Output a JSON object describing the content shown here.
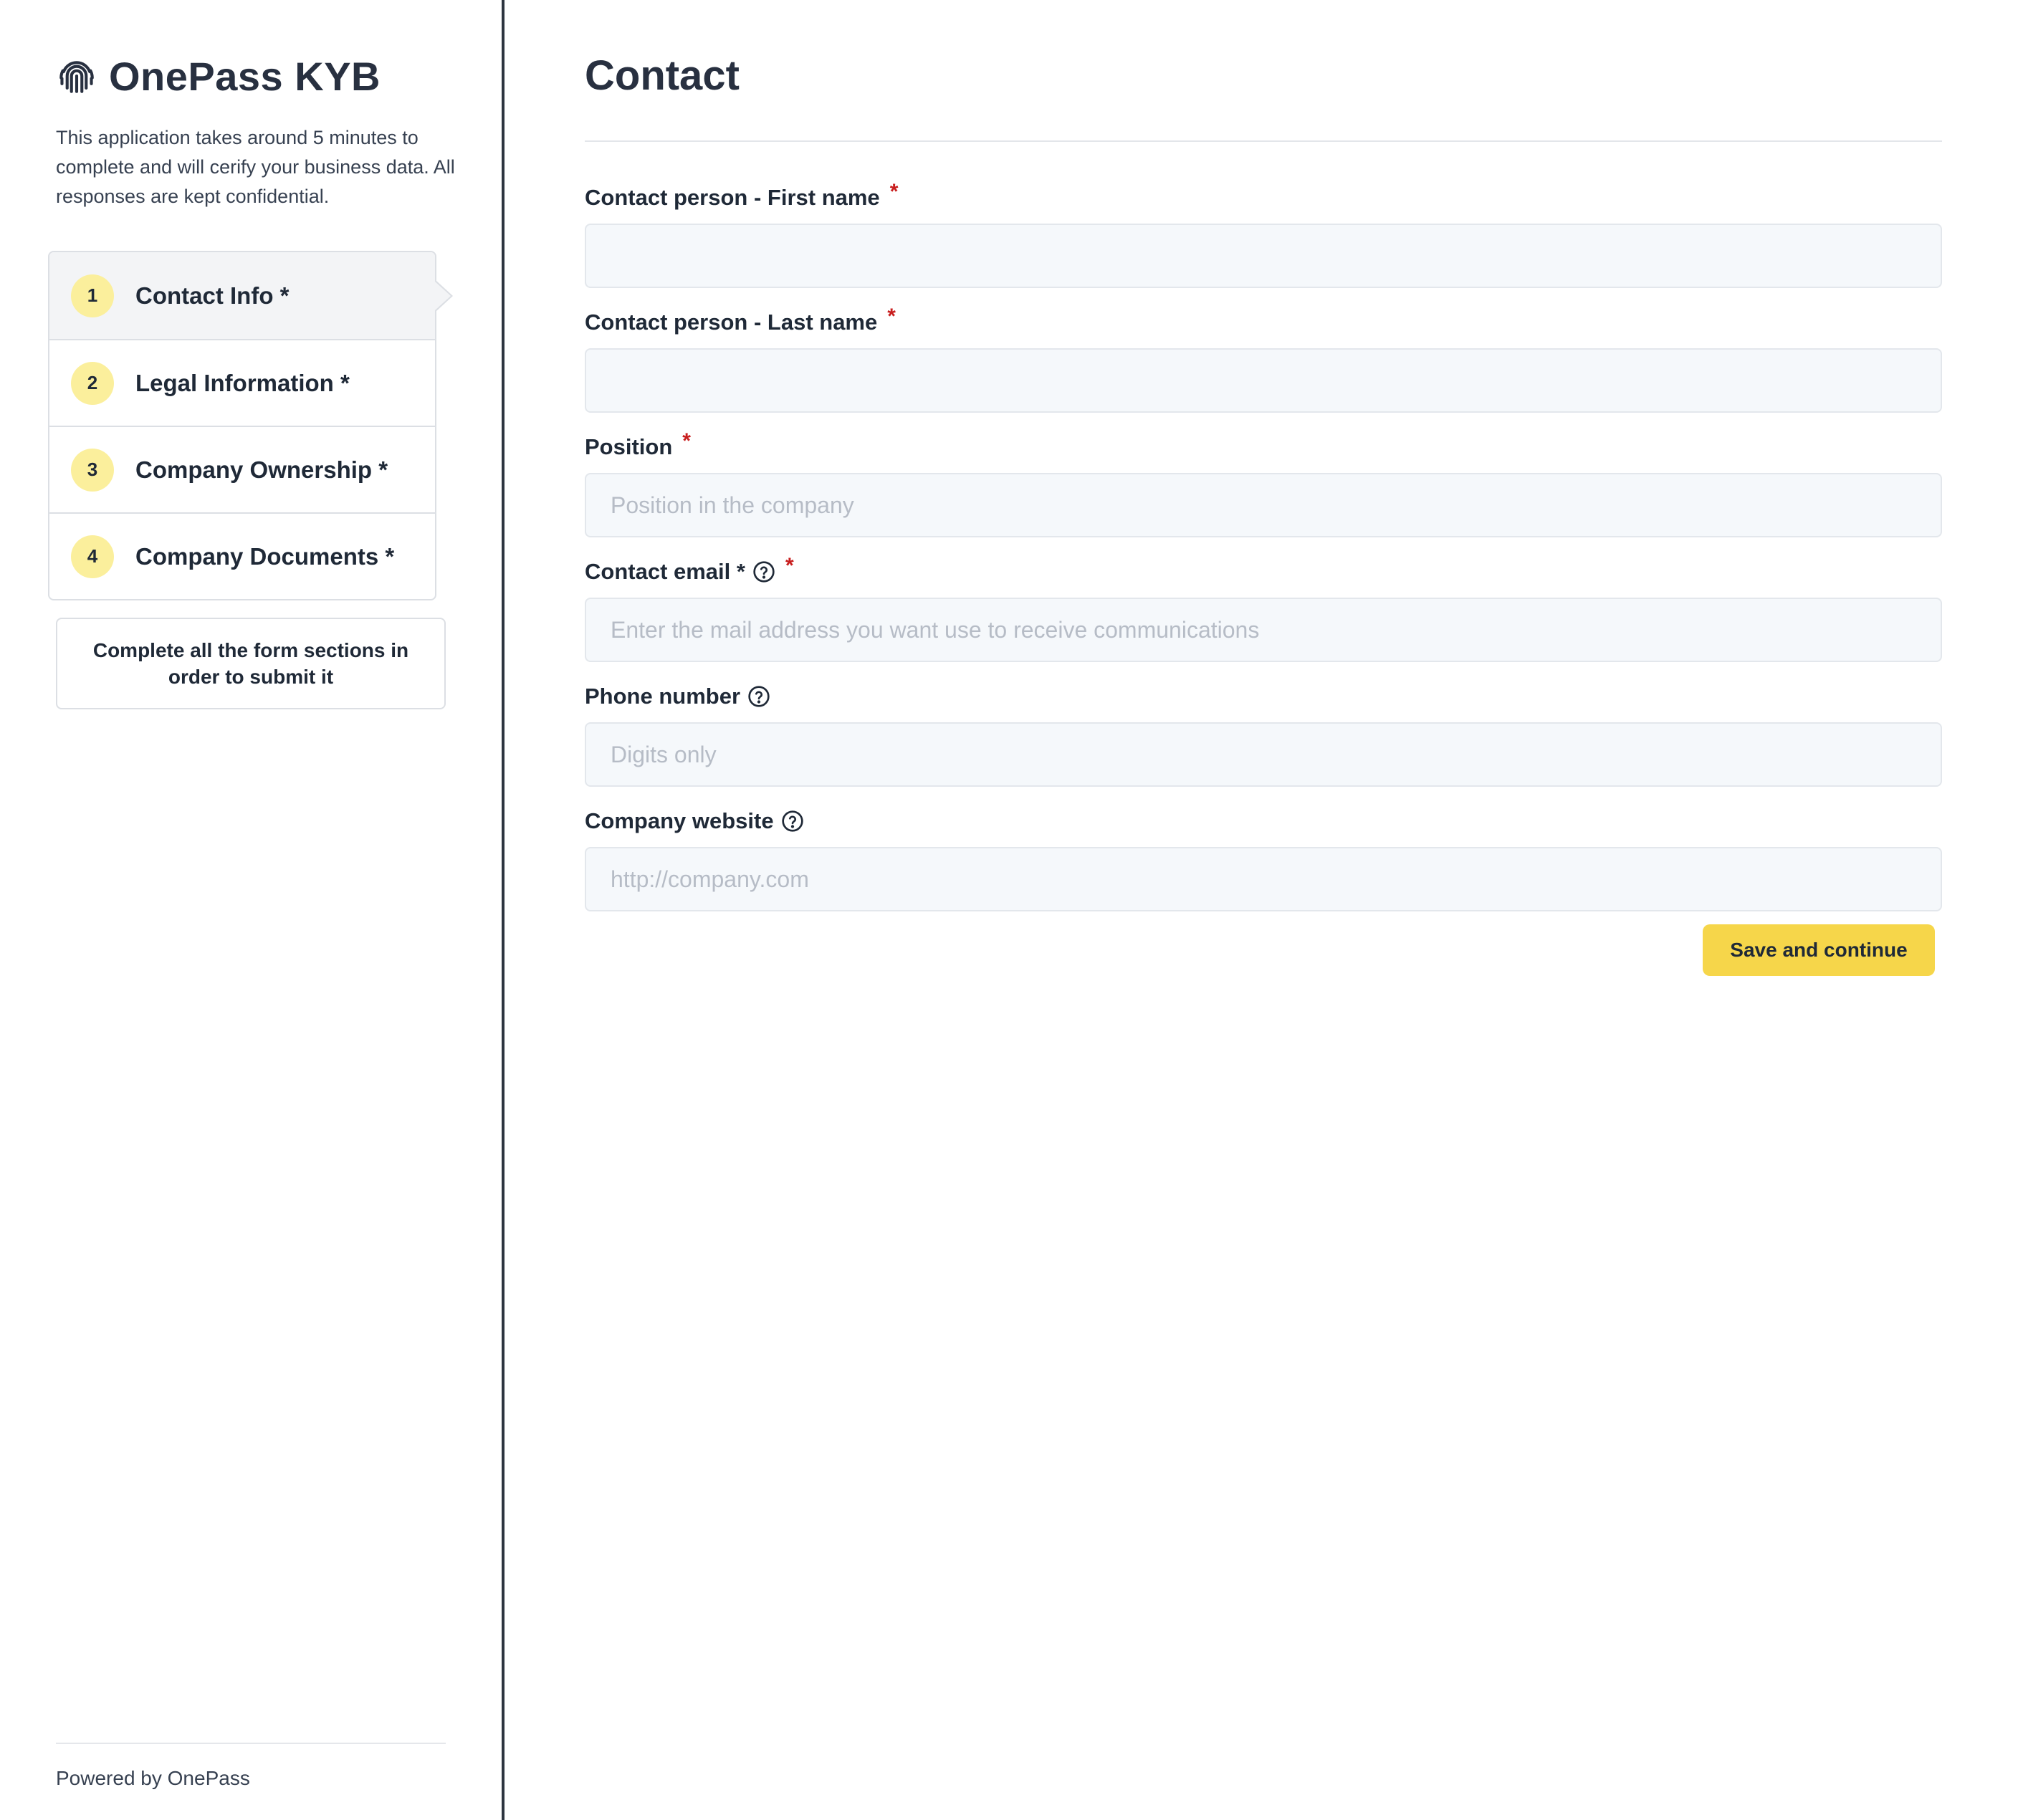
{
  "brand": {
    "title": "OnePass KYB",
    "icon": "fingerprint-icon"
  },
  "sidebar": {
    "intro": "This application takes around 5 minutes to complete and will cerify your business data. All responses are kept confidential.",
    "steps": [
      {
        "number": "1",
        "label": "Contact Info *",
        "active": true
      },
      {
        "number": "2",
        "label": "Legal Information *",
        "active": false
      },
      {
        "number": "3",
        "label": "Company Ownership *",
        "active": false
      },
      {
        "number": "4",
        "label": "Company Documents *",
        "active": false
      }
    ],
    "notice": "Complete all the form sections in order to submit it",
    "footer": "Powered by OnePass"
  },
  "main": {
    "title": "Contact",
    "fields": {
      "first_name": {
        "label": "Contact person - First name",
        "required": "*",
        "value": "",
        "placeholder": ""
      },
      "last_name": {
        "label": "Contact person - Last name",
        "required": "*",
        "value": "",
        "placeholder": ""
      },
      "position": {
        "label": "Position",
        "required": "*",
        "value": "",
        "placeholder": "Position in the company"
      },
      "email": {
        "label": "Contact email *",
        "required": "*",
        "value": "",
        "placeholder": "Enter the mail address you want use to receive communications",
        "help_icon": "question-circle-icon"
      },
      "phone": {
        "label": "Phone number",
        "value": "",
        "placeholder": "Digits only",
        "help_icon": "question-circle-icon"
      },
      "website": {
        "label": "Company website",
        "value": "",
        "placeholder": "http://company.com",
        "help_icon": "question-circle-icon"
      }
    },
    "save_label": "Save and continue"
  },
  "colors": {
    "accent": "#f6d64a",
    "step_badge": "#fbef9c",
    "required": "#c81e1e",
    "heading": "#283040",
    "input_bg": "#f5f8fb"
  }
}
